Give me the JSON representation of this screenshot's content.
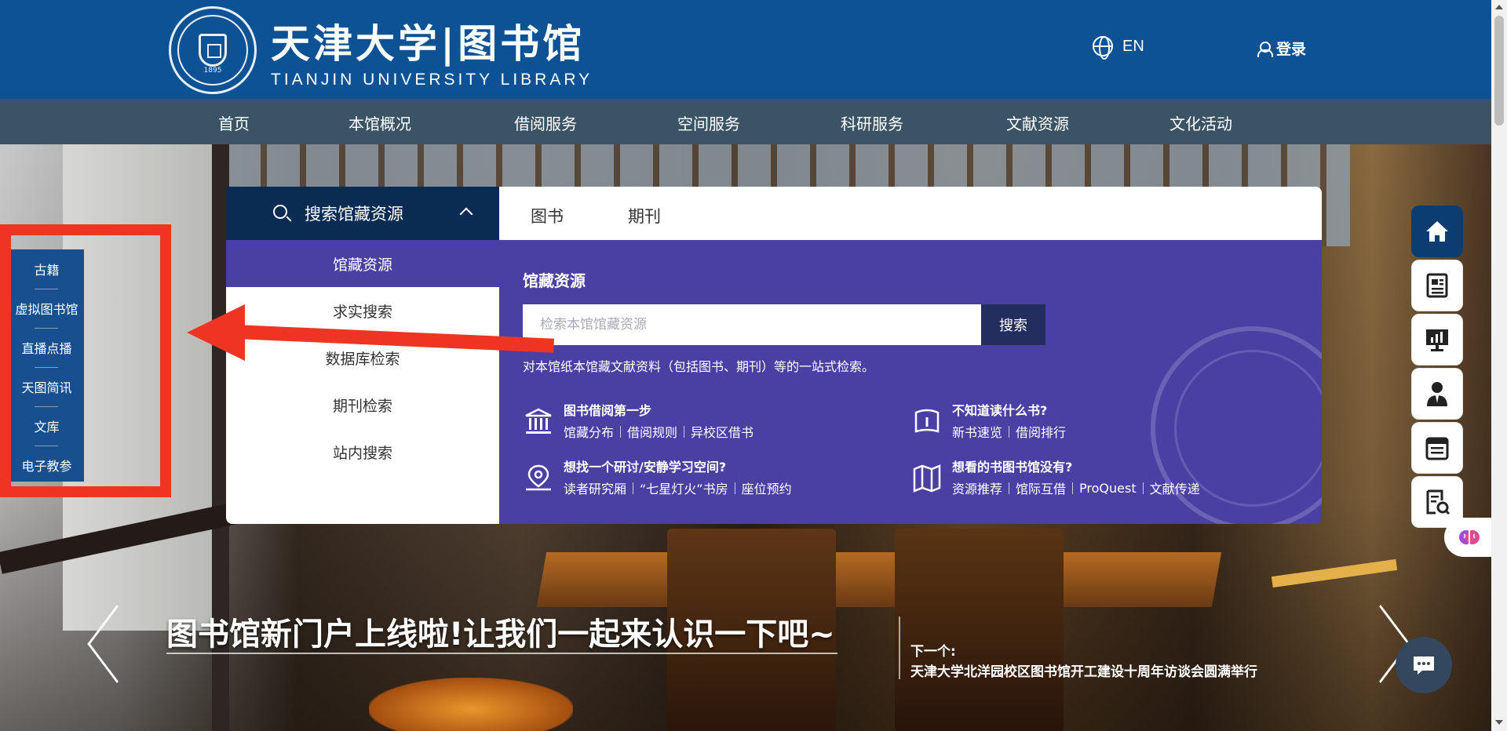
{
  "header": {
    "logo_cn": "天津大学|图书馆",
    "logo_en": "TIANJIN UNIVERSITY LIBRARY",
    "seal_year": "1895",
    "lang_label": "EN",
    "login_label": "登录",
    "colors": {
      "header_bg": "#0c5295",
      "nav_bg": "#3b5465"
    }
  },
  "nav": {
    "items": [
      {
        "label": "首页"
      },
      {
        "label": "本馆概况"
      },
      {
        "label": "借阅服务"
      },
      {
        "label": "空间服务"
      },
      {
        "label": "科研服务"
      },
      {
        "label": "文献资源"
      },
      {
        "label": "文化活动"
      }
    ]
  },
  "quick_links": {
    "items": [
      {
        "label": "古籍"
      },
      {
        "label": "虚拟图书馆"
      },
      {
        "label": "直播点播"
      },
      {
        "label": "天图简讯"
      },
      {
        "label": "文库"
      },
      {
        "label": "电子教参"
      }
    ]
  },
  "search": {
    "head_label": "搜索馆藏资源",
    "tabs": [
      "图书",
      "期刊"
    ],
    "menu": [
      "馆藏资源",
      "求实搜索",
      "数据库检索",
      "期刊检索",
      "站内搜索"
    ],
    "active_menu": "馆藏资源",
    "title": "馆藏资源",
    "input_placeholder": "检索本馆馆藏资源",
    "button_label": "搜索",
    "description": "对本馆纸本馆藏文献资料（包括图书、期刊）等的一站式检索。",
    "cards": [
      {
        "icon": "library-building-icon",
        "title": "图书借阅第一步",
        "links": [
          "馆藏分布",
          "借阅规则",
          "异校区借书"
        ]
      },
      {
        "icon": "book-question-icon",
        "title": "不知道读什么书?",
        "links": [
          "新书速览",
          "借阅排行"
        ]
      },
      {
        "icon": "location-pin-icon",
        "title": "想找一个研讨/安静学习空间?",
        "links": [
          "读者研究厢",
          "“七星灯火”书房",
          "座位预约"
        ]
      },
      {
        "icon": "map-icon",
        "title": "想看的书图书馆没有?",
        "links": [
          "资源推荐",
          "馆际互借",
          "ProQuest",
          "文献传递"
        ]
      }
    ],
    "colors": {
      "panel_purple": "#4a40a4",
      "head_dark": "#0a2b52"
    }
  },
  "toolbar": {
    "items": [
      {
        "icon": "home-icon"
      },
      {
        "icon": "news-icon"
      },
      {
        "icon": "presentation-chart-icon"
      },
      {
        "icon": "librarian-icon"
      },
      {
        "icon": "calendar-icon"
      },
      {
        "icon": "document-search-icon"
      }
    ]
  },
  "carousel": {
    "caption": "图书馆新门户上线啦!让我们一起来认识一下吧~",
    "next_label": "下一个:",
    "next_title": "天津大学北洋园校区图书馆开工建设十周年访谈会圆满举行"
  },
  "annotation": {
    "color": "#ee3524"
  }
}
